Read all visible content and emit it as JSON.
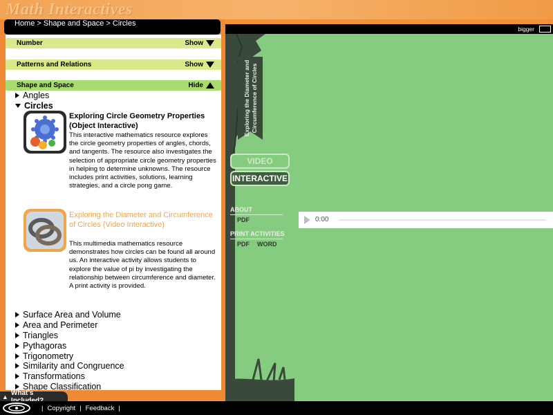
{
  "site": {
    "title": "Math Interactives"
  },
  "breadcrumb": "Home > Shape and Space > Circles",
  "strands": [
    {
      "label": "Number",
      "toggle": "Show"
    },
    {
      "label": "Patterns and Relations",
      "toggle": "Show"
    },
    {
      "label": "Shape and Space",
      "toggle": "Hide"
    }
  ],
  "topics_above": [
    {
      "label": "Angles"
    },
    {
      "label": "Circles"
    }
  ],
  "resources": [
    {
      "title": "Exploring Circle Geometry Properties (Object Interactive)",
      "description": "This interactive mathematics resource explores the circle geometry properties of angles, chords, and tangents. The resource also investigates the selection of appropriate circle geometry properties in helping to determine unknowns. The resource includes print activities, solutions, learning strategies, and a circle pong game."
    },
    {
      "title": "Exploring the Diameter and Circumference of Circles (Video Interactive)",
      "description": "This multimedia mathematics resource demonstrates how circles can be found all around us. An interactive activity allows students to explore the value of pi by investigating the relationship between circumference and diameter. A print activity is provided."
    }
  ],
  "topics_below": [
    {
      "label": "Surface Area and Volume"
    },
    {
      "label": "Area and Perimeter"
    },
    {
      "label": "Triangles"
    },
    {
      "label": "Pythagoras"
    },
    {
      "label": "Trigonometry"
    },
    {
      "label": "Similarity and Congruence"
    },
    {
      "label": "Transformations"
    },
    {
      "label": "Shape Classification"
    }
  ],
  "whats_included": "What's Included?",
  "footer": {
    "sep": "|",
    "copyright": "Copyright",
    "feedback": "Feedback"
  },
  "player_panel": {
    "bigger": "bigger",
    "banner_line1": "Exploring the Diameter and",
    "banner_line2": "Circumference of Circles",
    "video_btn": "VIDEO",
    "interactive_btn": "INTERACTIVE",
    "about_label": "ABOUT",
    "about_pdf": "PDF",
    "print_label": "PRINT ACTIVITIES",
    "print_pdf": "PDF",
    "print_word": "WORD",
    "time": "0:00"
  },
  "colors": {
    "orange": "#f0923a",
    "strand_green": "#dbe98c",
    "active_green": "#a8dc6e",
    "panel_green": "#85cb80",
    "link_orange": "#f0a54a"
  }
}
